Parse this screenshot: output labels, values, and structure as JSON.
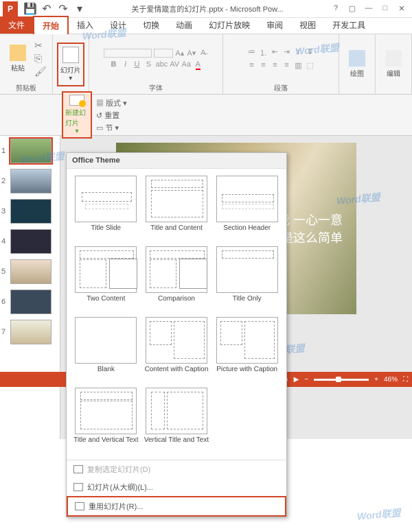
{
  "title": "关于爱情箴言的幻灯片.pptx - Microsoft Pow...",
  "app_initial": "P",
  "tabs": {
    "file": "文件",
    "home": "开始",
    "insert": "插入",
    "design": "设计",
    "transitions": "切换",
    "animations": "动画",
    "slideshow": "幻灯片放映",
    "review": "审阅",
    "view": "视图",
    "developer": "开发工具"
  },
  "ribbon": {
    "clipboard": {
      "label": "剪贴板",
      "paste": "粘贴"
    },
    "slides": {
      "label": "幻灯片",
      "btn": "幻灯片"
    },
    "font": {
      "label": "字体"
    },
    "paragraph": {
      "label": "段落"
    },
    "drawing": {
      "label": "绘图"
    },
    "editing": {
      "label": "编辑"
    }
  },
  "subbar": {
    "new_slide": "新建幻灯片",
    "layout": "版式",
    "reset": "重置",
    "section": "节"
  },
  "thumbs": [
    "1",
    "2",
    "3",
    "4",
    "5",
    "6",
    "7"
  ],
  "slide_text": {
    "l1": "我 一心一意",
    "l2": "就是这么简单"
  },
  "zoom": "46%",
  "layout_menu": {
    "title": "Office Theme",
    "items": [
      "Title Slide",
      "Title and Content",
      "Section Header",
      "Two Content",
      "Comparison",
      "Title Only",
      "Blank",
      "Content with Caption",
      "Picture with Caption",
      "Title and Vertical Text",
      "Vertical Title and Text"
    ],
    "footer": {
      "duplicate": "复制选定幻灯片(D)",
      "outline": "幻灯片(从大纲)(L)...",
      "reuse": "重用幻灯片(R)..."
    }
  },
  "watermark": "Word联盟"
}
